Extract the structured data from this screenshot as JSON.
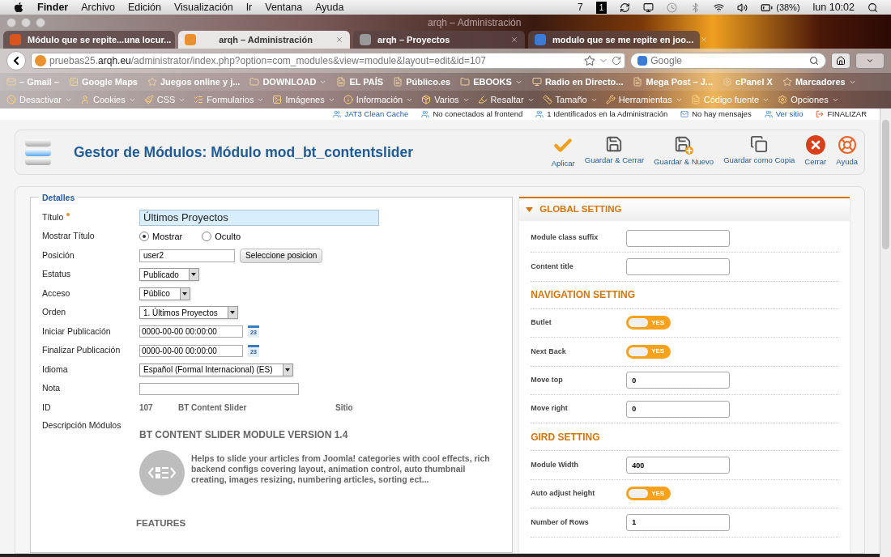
{
  "menubar": {
    "items": [
      {
        "label": "Finder",
        "bold": true
      },
      {
        "label": "Archivo",
        "bold": false
      },
      {
        "label": "Edición",
        "bold": false
      },
      {
        "label": "Visualización",
        "bold": false
      },
      {
        "label": "Ir",
        "bold": false
      },
      {
        "label": "Ventana",
        "bold": false
      },
      {
        "label": "Ayuda",
        "bold": false
      }
    ],
    "status": {
      "badge": "7",
      "desktop": "1",
      "battery": "(38%)",
      "clock": "lun 10:02"
    }
  },
  "window": {
    "title": "arqh – Administración"
  },
  "tabs": [
    {
      "label": "Módulo que se repite...una locur...",
      "selected": false,
      "color": "#d9541e"
    },
    {
      "label": "arqh – Administración",
      "selected": true,
      "color": "#e8912e"
    },
    {
      "label": "arqh – Proyectos",
      "selected": false,
      "color": "#999999"
    },
    {
      "label": "modulo que se me repite en joo...",
      "selected": false,
      "color": "#3b7bd6"
    }
  ],
  "address": {
    "url": "pruebas25.**arqh.eu**/administrator/index.php?option=com_modules&view=module&layout=edit&id=107",
    "search_placeholder": "Google"
  },
  "bookmarks": [
    {
      "label": "– Gmail –",
      "menu": false
    },
    {
      "label": "Google Maps",
      "menu": false
    },
    {
      "label": "Juegos online y j...",
      "menu": false
    },
    {
      "label": "DOWNLOAD",
      "menu": true
    },
    {
      "label": "EL PAÍS",
      "menu": false
    },
    {
      "label": "Público.es",
      "menu": false
    },
    {
      "label": "EBOOKS",
      "menu": true
    },
    {
      "label": "Radio en Directo...",
      "menu": false
    },
    {
      "label": "Mega Post – J...",
      "menu": false
    },
    {
      "label": "cPanel X",
      "menu": false
    },
    {
      "label": "Marcadores",
      "menu": true
    }
  ],
  "dev_toolbar": [
    {
      "label": "Desactivar"
    },
    {
      "label": "Cookies"
    },
    {
      "label": "CSS"
    },
    {
      "label": "Formularios"
    },
    {
      "label": "Imágenes"
    },
    {
      "label": "Información"
    },
    {
      "label": "Varios"
    },
    {
      "label": "Resaltar"
    },
    {
      "label": "Tamaño"
    },
    {
      "label": "Herramientas"
    },
    {
      "label": "Código fuente"
    },
    {
      "label": "Opciones"
    }
  ],
  "admin_status": [
    {
      "label": "JAT3 Clean Cache",
      "link": true
    },
    {
      "label": "No conectados al frontend",
      "link": false
    },
    {
      "label": "1 Identificados en la Administración",
      "link": false
    },
    {
      "label": "No hay mensajes",
      "link": false
    },
    {
      "label": "Ver sitio",
      "link": true
    },
    {
      "label": "FINALIZAR",
      "link": false
    }
  ],
  "page_title": "Gestor de Módulos: Módulo mod_bt_contentslider",
  "actions": [
    {
      "label": "Aplicar",
      "kind": "apply"
    },
    {
      "label": "Guardar & Cerrar",
      "kind": "save"
    },
    {
      "label": "Guardar & Nuevo",
      "kind": "save-new"
    },
    {
      "label": "Guardar como Copia",
      "kind": "copy"
    },
    {
      "label": "Cerrar",
      "kind": "close"
    },
    {
      "label": "Ayuda",
      "kind": "help"
    }
  ],
  "details": {
    "legend": "Detalles",
    "rows": [
      {
        "label": "Título",
        "required": true,
        "kind": "title",
        "value": "Últimos Proyectos"
      },
      {
        "label": "Mostrar Título",
        "kind": "radio",
        "options": [
          {
            "label": "Mostrar",
            "selected": true
          },
          {
            "label": "Oculto",
            "selected": false
          }
        ]
      },
      {
        "label": "Posición",
        "kind": "position",
        "value": "user2",
        "button": "Seleccione posicion"
      },
      {
        "label": "Estatus",
        "kind": "select",
        "value": "Publicado"
      },
      {
        "label": "Acceso",
        "kind": "select",
        "value": "Público"
      },
      {
        "label": "Orden",
        "kind": "select",
        "value": "1. Últimos Proyectos"
      },
      {
        "label": "Iniciar Publicación",
        "kind": "date",
        "value": "0000-00-00 00:00:00",
        "day": "23"
      },
      {
        "label": "Finalizar Publicación",
        "kind": "date",
        "value": "0000-00-00 00:00:00",
        "day": "23"
      },
      {
        "label": "Idioma",
        "kind": "select",
        "value": "Español (Formal Internacional) (ES)"
      },
      {
        "label": "Nota",
        "kind": "text"
      },
      {
        "label": "ID",
        "kind": "static",
        "values": [
          "107",
          "BT Content Slider",
          "Sitio"
        ]
      }
    ],
    "description": {
      "label": "Descripción Módulos",
      "heading": "BT CONTENT SLIDER MODULE VERSION 1.4",
      "text": "Helps to slide your articles from Joomla! categories with cool effects, rich backend configs covering layout, animation control, auto thumbnail creating, images resizing, numbering articles, sorting ect...",
      "features": "FEATURES"
    }
  },
  "settings": {
    "header": "GLOBAL SETTING",
    "expanded": true,
    "rows": [
      {
        "kind": "field",
        "label": "Module class suffix"
      },
      {
        "kind": "field",
        "label": "Content title"
      },
      {
        "kind": "heading",
        "label": "NAVIGATION SETTING"
      },
      {
        "kind": "toggle",
        "label": "Butlet",
        "on": true,
        "text": "YES"
      },
      {
        "kind": "toggle",
        "label": "Next Back",
        "on": true,
        "text": "YES"
      },
      {
        "kind": "field",
        "label": "Move top",
        "value": "0"
      },
      {
        "kind": "field",
        "label": "Move right",
        "value": "0"
      },
      {
        "kind": "heading",
        "label": "GIRD SETTING"
      },
      {
        "kind": "field",
        "label": "Module Width",
        "value": "400"
      },
      {
        "kind": "toggle",
        "label": "Auto adjust height",
        "on": true,
        "text": "YES"
      },
      {
        "kind": "field",
        "label": "Number of Rows",
        "value": "1"
      }
    ]
  }
}
